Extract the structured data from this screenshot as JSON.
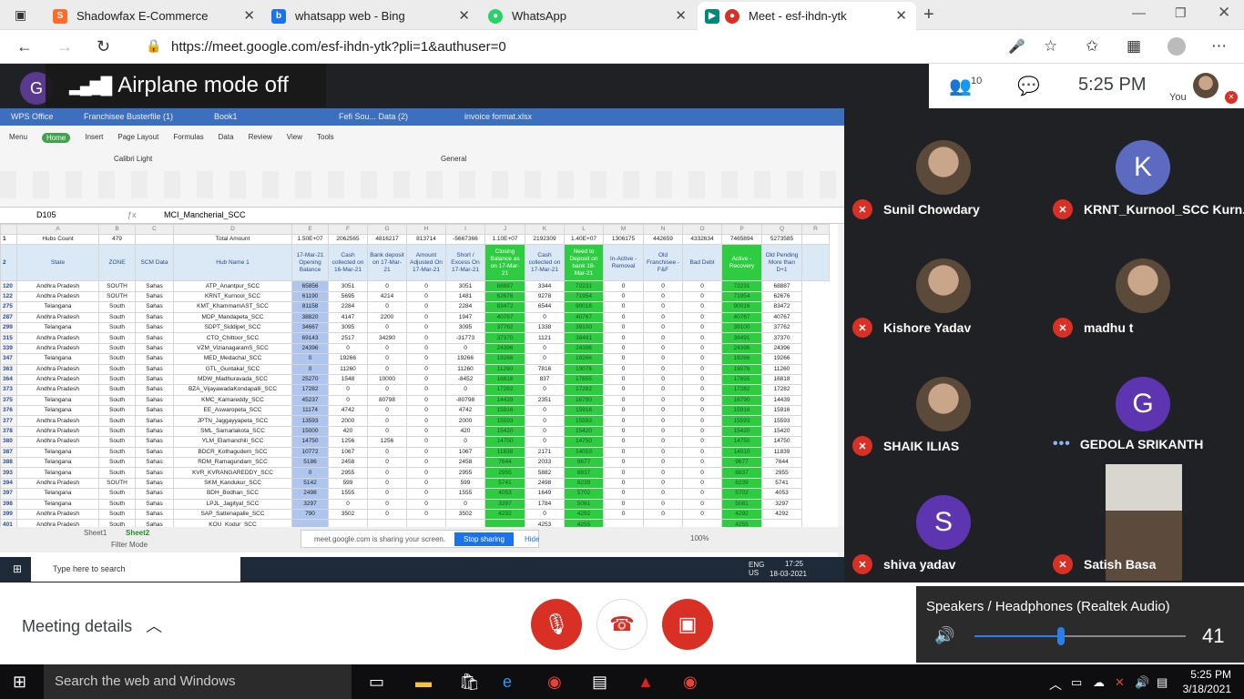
{
  "browser": {
    "tabs": [
      {
        "title": "Shadowfax E-Commerce",
        "favicon_color": "#ff6b2b",
        "active": false
      },
      {
        "title": "whatsapp web - Bing",
        "favicon_color": "#1a73e8",
        "active": false
      },
      {
        "title": "WhatsApp",
        "favicon_color": "#25d366",
        "active": false
      },
      {
        "title": "Meet - esf-ihdn-ytk",
        "favicon_color": "#00897b",
        "active": true
      }
    ],
    "url": "https://meet.google.com/esf-ihdn-ytk?pli=1&authuser=0"
  },
  "meet": {
    "presenter_initial": "G",
    "banner_text": "Airplane mode off",
    "participant_count": "10",
    "time": "5:25 PM",
    "self_label": "You",
    "participants": [
      {
        "name": "Sunil Chowdary",
        "initial": "",
        "photo": true,
        "muted": true
      },
      {
        "name": "KRNT_Kurnool_SCC Kurn...",
        "initial": "K",
        "color": "#5c6bc0",
        "muted": true
      },
      {
        "name": "Kishore Yadav",
        "initial": "",
        "photo": true,
        "muted": true
      },
      {
        "name": "madhu t",
        "initial": "",
        "photo": true,
        "muted": true
      },
      {
        "name": "SHAIK ILIAS",
        "initial": "",
        "photo": true,
        "muted": true
      },
      {
        "name": "GEDOLA SRIKANTH",
        "initial": "G",
        "color": "#5e35b1",
        "muted": false
      },
      {
        "name": "shiva yadav",
        "initial": "S",
        "color": "#5e35b1",
        "muted": true
      },
      {
        "name": "Satish Basa",
        "initial": "",
        "photo": true,
        "muted": true
      }
    ],
    "meeting_details": "Meeting details",
    "audio_device": "Speakers / Headphones (Realtek Audio)",
    "volume": 41
  },
  "shared": {
    "wps_tabs": [
      "WPS Office",
      "Franchisee Busterfile (1)",
      "Book1",
      "Fefi Sou... Data (2)",
      "invoice format.xlsx"
    ],
    "menu": [
      "Menu",
      "Home",
      "Insert",
      "Page Layout",
      "Formulas",
      "Data",
      "Review",
      "View",
      "Tools"
    ],
    "font": "Calibri Light",
    "number_format": "General",
    "cell_ref": "D105",
    "formula": "MCI_Mancherial_SCC",
    "col_letters": [
      "A",
      "B",
      "C",
      "D",
      "E",
      "F",
      "G",
      "H",
      "I",
      "J",
      "K",
      "L",
      "M",
      "N",
      "O",
      "P",
      "Q",
      "R"
    ],
    "totals": [
      "Hubs Count",
      "479",
      "",
      "Total Amount",
      "1.50E+07",
      "2062565",
      "4816217",
      "813714",
      "-5667366",
      "1.10E+07",
      "2192309",
      "1.40E+07",
      "1306175",
      "442659",
      "4332634",
      "7465894",
      "5273585",
      ""
    ],
    "headers": [
      "State",
      "ZONE",
      "SCM Data",
      "Hub Name 1",
      "17-Mar-21 Opening Balance",
      "Cash collected on 16-Mar-21",
      "Bank deposit on 17-Mar-21",
      "Amount Adjusted On 17-Mar-21",
      "Short / Excess On 17-Mar-21",
      "Closing Balance as on 17-Mar-21",
      "Cash collected on 17-Mar-21",
      "Need to Deposit on bank 18-Mar-21",
      "In-Active - Removal",
      "Old Franchisee - F&F",
      "Bad Debt",
      "Active - Recovery",
      "Old Pending More than D+1",
      ""
    ],
    "rows": [
      [
        "120",
        "Andhra Pradesh",
        "SOUTH",
        "Sahas",
        "ATP_Anantpur_SCC",
        "65856",
        "3051",
        "0",
        "0",
        "3051",
        "68887",
        "3344",
        "72231",
        "0",
        "0",
        "0",
        "72231",
        "68887"
      ],
      [
        "122",
        "Andhra Pradesh",
        "SOUTH",
        "Sahas",
        "KRNT_Kurnool_SCC",
        "61190",
        "5695",
        "4214",
        "0",
        "1481",
        "62676",
        "9278",
        "71954",
        "0",
        "0",
        "0",
        "71954",
        "62676"
      ],
      [
        "275",
        "Telangana",
        "South",
        "Sahas",
        "KMT_KhammamAST_SCC",
        "81158",
        "2284",
        "0",
        "0",
        "2284",
        "83472",
        "6544",
        "90016",
        "0",
        "0",
        "0",
        "90016",
        "83472"
      ],
      [
        "287",
        "Andhra Pradesh",
        "South",
        "Sahas",
        "MDP_Mandapeta_SCC",
        "38820",
        "4147",
        "2200",
        "0",
        "1947",
        "40767",
        "0",
        "40767",
        "0",
        "0",
        "0",
        "40767",
        "40767"
      ],
      [
        "299",
        "Telangana",
        "South",
        "Sahas",
        "SDPT_Siddipet_SCC",
        "34667",
        "3095",
        "0",
        "0",
        "3095",
        "37762",
        "1338",
        "39100",
        "0",
        "0",
        "0",
        "39100",
        "37762"
      ],
      [
        "315",
        "Andhra Pradesh",
        "South",
        "Sahas",
        "CTO_Chittoor_SCC",
        "69143",
        "2517",
        "34290",
        "0",
        "-31773",
        "37370",
        "1121",
        "38491",
        "0",
        "0",
        "0",
        "38491",
        "37370"
      ],
      [
        "339",
        "Andhra Pradesh",
        "South",
        "Sahas",
        "VZM_VizianagaramS_SCC",
        "24396",
        "0",
        "0",
        "0",
        "0",
        "24396",
        "0",
        "24396",
        "0",
        "0",
        "0",
        "24396",
        "24396"
      ],
      [
        "347",
        "Telangana",
        "South",
        "Sahas",
        "MED_Medachal_SCC",
        "0",
        "19266",
        "0",
        "0",
        "19266",
        "19266",
        "0",
        "19266",
        "0",
        "0",
        "0",
        "19266",
        "19266"
      ],
      [
        "363",
        "Andhra Pradesh",
        "South",
        "Sahas",
        "GTL_Guntakal_SCC",
        "0",
        "11260",
        "0",
        "0",
        "11260",
        "11260",
        "7816",
        "19076",
        "0",
        "0",
        "0",
        "19076",
        "11260"
      ],
      [
        "364",
        "Andhra Pradesh",
        "South",
        "Sahas",
        "MDW_Madhuravada_SCC",
        "25270",
        "1548",
        "10000",
        "0",
        "-8452",
        "16818",
        "837",
        "17655",
        "0",
        "0",
        "0",
        "17655",
        "16818"
      ],
      [
        "373",
        "Andhra Pradesh",
        "South",
        "Sahas",
        "BZA_VijayawadaKondapalli_SCC",
        "17282",
        "0",
        "0",
        "0",
        "0",
        "17282",
        "0",
        "17282",
        "0",
        "0",
        "0",
        "17282",
        "17282"
      ],
      [
        "375",
        "Telangana",
        "South",
        "Sahas",
        "KMC_Kamareddy_SCC",
        "45237",
        "0",
        "80798",
        "0",
        "-80798",
        "14439",
        "2351",
        "16790",
        "0",
        "0",
        "0",
        "16790",
        "14439"
      ],
      [
        "376",
        "Telangana",
        "South",
        "Sahas",
        "EE_Aswaropeta_SCC",
        "11174",
        "4742",
        "0",
        "0",
        "4742",
        "15916",
        "0",
        "15916",
        "0",
        "0",
        "0",
        "15916",
        "15916"
      ],
      [
        "377",
        "Andhra Pradesh",
        "South",
        "Sahas",
        "JPTN_Jaggayyapeta_SCC",
        "13593",
        "2000",
        "0",
        "0",
        "2000",
        "15593",
        "0",
        "15593",
        "0",
        "0",
        "0",
        "15593",
        "15593"
      ],
      [
        "378",
        "Andhra Pradesh",
        "South",
        "Sahas",
        "SML_Samarlakota_SCC",
        "15000",
        "420",
        "0",
        "0",
        "420",
        "15420",
        "0",
        "15420",
        "0",
        "0",
        "0",
        "15420",
        "15420"
      ],
      [
        "380",
        "Andhra Pradesh",
        "South",
        "Sahas",
        "YLM_Elamanchili_SCC",
        "14750",
        "1256",
        "1256",
        "0",
        "0",
        "14750",
        "0",
        "14750",
        "0",
        "0",
        "0",
        "14750",
        "14750"
      ],
      [
        "387",
        "Telangana",
        "South",
        "Sahas",
        "BDCR_Kothagudem_SCC",
        "10772",
        "1067",
        "0",
        "0",
        "1067",
        "11839",
        "2171",
        "14010",
        "0",
        "0",
        "0",
        "14010",
        "11839"
      ],
      [
        "388",
        "Telangana",
        "South",
        "Sahas",
        "RDM_Ramagundam_SCC",
        "5186",
        "2458",
        "0",
        "0",
        "2458",
        "7644",
        "2033",
        "9677",
        "0",
        "0",
        "0",
        "9677",
        "7644"
      ],
      [
        "393",
        "Telangana",
        "South",
        "Sahas",
        "KVR_KVRANGAREDDY_SCC",
        "0",
        "2955",
        "0",
        "0",
        "2955",
        "2955",
        "5882",
        "8837",
        "0",
        "0",
        "0",
        "8837",
        "2955"
      ],
      [
        "394",
        "Andhra Pradesh",
        "SOUTH",
        "Sahas",
        "SKM_Kandukur_SCC",
        "5142",
        "599",
        "0",
        "0",
        "599",
        "5741",
        "2498",
        "8239",
        "0",
        "0",
        "0",
        "8239",
        "5741"
      ],
      [
        "397",
        "Telangana",
        "South",
        "Sahas",
        "BDH_Bodhan_SCC",
        "2498",
        "1555",
        "0",
        "0",
        "1555",
        "4053",
        "1649",
        "5702",
        "0",
        "0",
        "0",
        "5702",
        "4053"
      ],
      [
        "398",
        "Telangana",
        "South",
        "Sahas",
        "LPJL_Jagityal_SCC",
        "3297",
        "0",
        "0",
        "0",
        "0",
        "3297",
        "1784",
        "5081",
        "0",
        "0",
        "0",
        "5081",
        "3297"
      ],
      [
        "399",
        "Andhra Pradesh",
        "South",
        "Sahas",
        "SAP_Sattenapalle_SCC",
        "790",
        "3502",
        "0",
        "0",
        "3502",
        "4292",
        "0",
        "4292",
        "0",
        "0",
        "0",
        "4292",
        "4292"
      ],
      [
        "401",
        "Andhra Pradesh",
        "South",
        "Sahas",
        "KOU_Kodur_SCC",
        "",
        "",
        "",
        "",
        "",
        "",
        "4253",
        "4255",
        "",
        "",
        "",
        "4255",
        ""
      ]
    ],
    "sheet_tabs": [
      "Sheet1",
      "Sheet2"
    ],
    "status": "Filter Mode",
    "sharing_text": "meet.google.com is sharing your screen.",
    "stop_sharing": "Stop sharing",
    "hide": "Hide",
    "zoom": "100%",
    "win_search": "Type here to search",
    "win_time": "17:25",
    "win_date": "18-03-2021",
    "win_lang": "ENG US"
  },
  "taskbar": {
    "search": "Search the web and Windows",
    "time": "5:25 PM",
    "date": "3/18/2021"
  }
}
